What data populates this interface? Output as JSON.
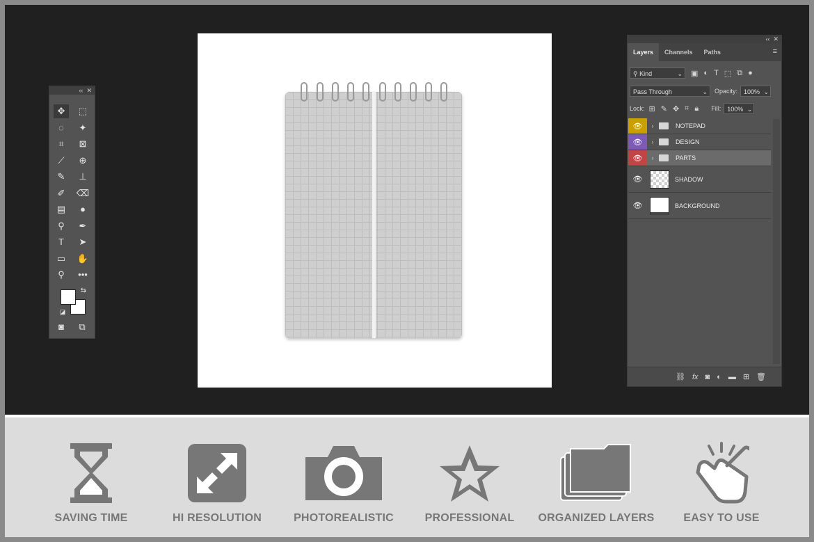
{
  "tools_panel": {
    "header_icons": [
      "collapse-icon",
      "close-icon"
    ],
    "tools": [
      {
        "icon": "move-tool-icon",
        "glyph": "✥",
        "active": true
      },
      {
        "icon": "marquee-tool-icon",
        "glyph": "⬚"
      },
      {
        "icon": "lasso-tool-icon",
        "glyph": "◌"
      },
      {
        "icon": "magic-wand-icon",
        "glyph": "✦"
      },
      {
        "icon": "crop-tool-icon",
        "glyph": "⌗"
      },
      {
        "icon": "frame-tool-icon",
        "glyph": "⊠"
      },
      {
        "icon": "eyedropper-icon",
        "glyph": "⟋"
      },
      {
        "icon": "healing-brush-icon",
        "glyph": "⊕"
      },
      {
        "icon": "brush-tool-icon",
        "glyph": "✎"
      },
      {
        "icon": "clone-stamp-icon",
        "glyph": "⊥"
      },
      {
        "icon": "history-brush-icon",
        "glyph": "✐"
      },
      {
        "icon": "eraser-tool-icon",
        "glyph": "⌫"
      },
      {
        "icon": "gradient-tool-icon",
        "glyph": "▤"
      },
      {
        "icon": "blur-tool-icon",
        "glyph": "●"
      },
      {
        "icon": "dodge-tool-icon",
        "glyph": "⚲"
      },
      {
        "icon": "pen-tool-icon",
        "glyph": "✒"
      },
      {
        "icon": "type-tool-icon",
        "glyph": "T"
      },
      {
        "icon": "path-selection-icon",
        "glyph": "➤"
      },
      {
        "icon": "rectangle-tool-icon",
        "glyph": "▭"
      },
      {
        "icon": "hand-tool-icon",
        "glyph": "✋"
      },
      {
        "icon": "zoom-tool-icon",
        "glyph": "⚲"
      },
      {
        "icon": "more-tools-icon",
        "glyph": "•••"
      }
    ],
    "foreground_color": "#ffffff",
    "background_color": "#ffffff"
  },
  "layers_panel": {
    "tabs": [
      {
        "label": "Layers",
        "active": true
      },
      {
        "label": "Channels"
      },
      {
        "label": "Paths"
      }
    ],
    "filter": {
      "kind_label": "Kind"
    },
    "blend_mode": "Pass Through",
    "opacity_label": "Opacity:",
    "opacity_value": "100%",
    "lock_label": "Lock:",
    "fill_label": "Fill:",
    "fill_value": "100%",
    "layers": [
      {
        "name": "NOTEPAD",
        "type": "group",
        "eye_color": "#c9a000"
      },
      {
        "name": "DESIGN",
        "type": "group",
        "eye_color": "#7d5ab5"
      },
      {
        "name": "PARTS",
        "type": "group",
        "eye_color": "#c24545",
        "selected": true
      },
      {
        "name": "SHADOW",
        "type": "layer",
        "thumb": "transparent"
      },
      {
        "name": "BACKGROUND",
        "type": "layer",
        "thumb": "white"
      }
    ]
  },
  "features": [
    {
      "label": "SAVING TIME",
      "icon": "hourglass-icon"
    },
    {
      "label": "HI RESOLUTION",
      "icon": "expand-arrows-icon"
    },
    {
      "label": "PHOTOREALISTIC",
      "icon": "camera-icon"
    },
    {
      "label": "PROFESSIONAL",
      "icon": "star-icon"
    },
    {
      "label": "ORGANIZED LAYERS",
      "icon": "stacked-folders-icon"
    },
    {
      "label": "EASY TO USE",
      "icon": "tap-hand-icon"
    }
  ]
}
